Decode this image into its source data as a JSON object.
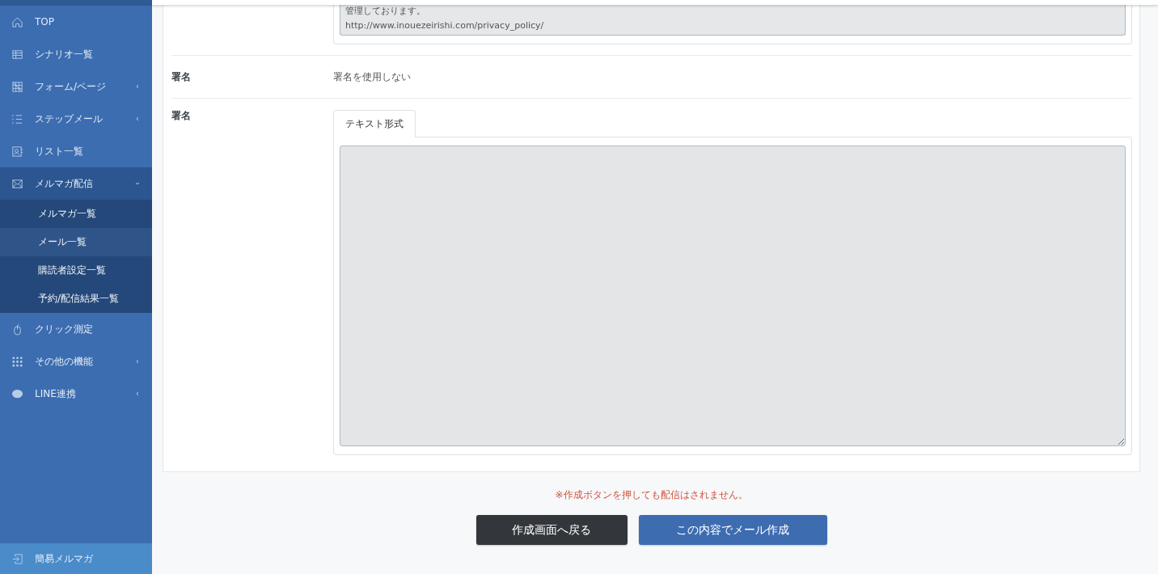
{
  "sidebar": {
    "items": [
      {
        "label": "TOP",
        "kind": "link"
      },
      {
        "label": "シナリオ一覧",
        "kind": "link"
      },
      {
        "label": "フォーム/ページ",
        "kind": "menu",
        "expanded": false
      },
      {
        "label": "ステップメール",
        "kind": "menu",
        "expanded": false
      },
      {
        "label": "リスト一覧",
        "kind": "link"
      },
      {
        "label": "メルマガ配信",
        "kind": "menu",
        "expanded": true,
        "children": [
          {
            "label": "メルマガ一覧",
            "selected": false
          },
          {
            "label": "メール一覧",
            "selected": true
          },
          {
            "label": "購読者設定一覧",
            "selected": false
          },
          {
            "label": "予約/配信結果一覧",
            "selected": false
          }
        ]
      },
      {
        "label": "クリック測定",
        "kind": "link"
      },
      {
        "label": "その他の機能",
        "kind": "menu",
        "expanded": false
      },
      {
        "label": "LINE連携",
        "kind": "menu",
        "expanded": false
      }
    ],
    "footer": {
      "label": "簡易メルマガ"
    }
  },
  "form": {
    "message_lines": [
      "管理しております。",
      "http://www.inouezeirishi.com/privacy_policy/"
    ],
    "signature_setting": {
      "label": "署名",
      "value": "署名を使用しない"
    },
    "signature": {
      "label": "署名",
      "tabs": [
        {
          "label": "テキスト形式",
          "selected": true
        }
      ]
    }
  },
  "notice": "※作成ボタンを押しても配信はされません。",
  "buttons": {
    "back": "作成画面へ戻る",
    "create": "この内容でメール作成"
  }
}
